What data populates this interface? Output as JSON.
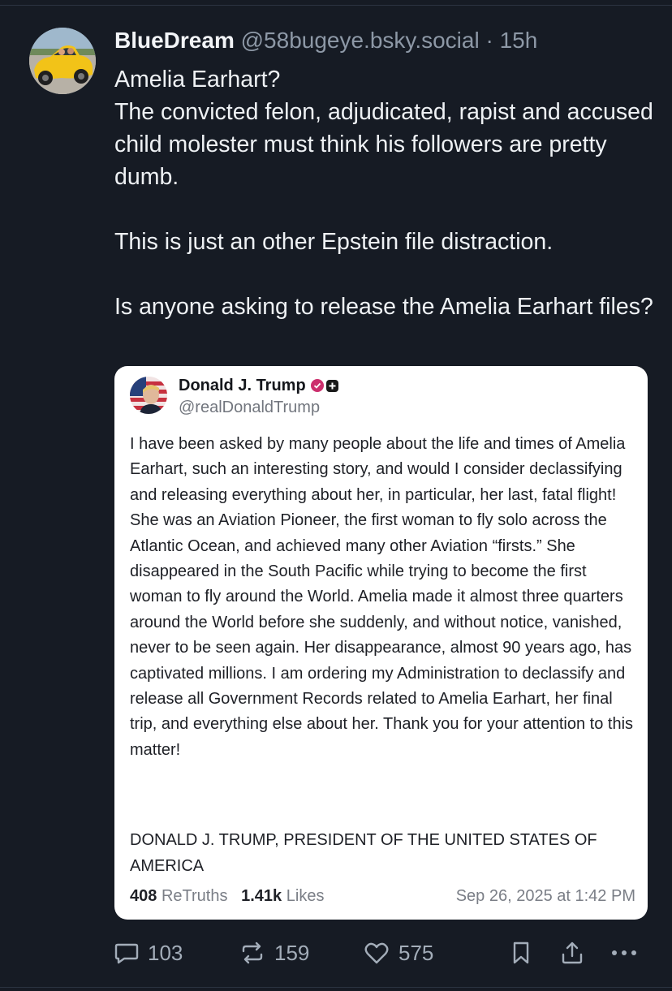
{
  "post": {
    "author": "BlueDream",
    "handle": "@58bugeye.bsky.social",
    "separator": "·",
    "time": "15h",
    "line1": "Amelia Earhart?",
    "line2": "The convicted felon, adjudicated, rapist and accused child molester must think his followers are pretty dumb.",
    "line3": "This is just an other Epstein file distraction.",
    "line4": "Is anyone asking to release the Amelia Earhart files?"
  },
  "embed": {
    "name": "Donald J. Trump",
    "handle": "@realDonaldTrump",
    "body": "I have been asked by many people about the life and times of Amelia Earhart, such an interesting story, and would I consider declassifying and releasing everything about her, in particular, her last, fatal flight! She was an Aviation Pioneer, the first woman to fly solo across the Atlantic Ocean, and achieved many other Aviation “firsts.” She disappeared in the South Pacific while trying to become the first woman to fly around the World. Amelia made it almost three quarters around the World before she suddenly, and without notice, vanished, never to be seen again. Her disappearance, almost 90 years ago, has captivated millions. I am ordering my Administration to declassify and release all Government Records related to Amelia Earhart, her final trip, and everything else about her. Thank you for your attention to this matter!",
    "signature": "DONALD J. TRUMP, PRESIDENT OF THE UNITED STATES OF AMERICA",
    "retruths_count": "408",
    "retruths_label": "ReTruths",
    "likes_count": "1.41k",
    "likes_label": "Likes",
    "date": "Sep 26, 2025 at 1:42 PM"
  },
  "actions": {
    "replies": "103",
    "reposts": "159",
    "likes": "575",
    "reply_icon": "speech-bubble-icon",
    "repost_icon": "repost-arrows-icon",
    "like_icon": "heart-icon",
    "bookmark_icon": "bookmark-icon",
    "share_icon": "share-icon",
    "more_icon": "ellipsis-icon"
  },
  "colors": {
    "background": "#161b24",
    "text": "#eef1f4",
    "muted": "#8d98a6",
    "card": "#ffffff",
    "verified": "#cc2f6d"
  }
}
